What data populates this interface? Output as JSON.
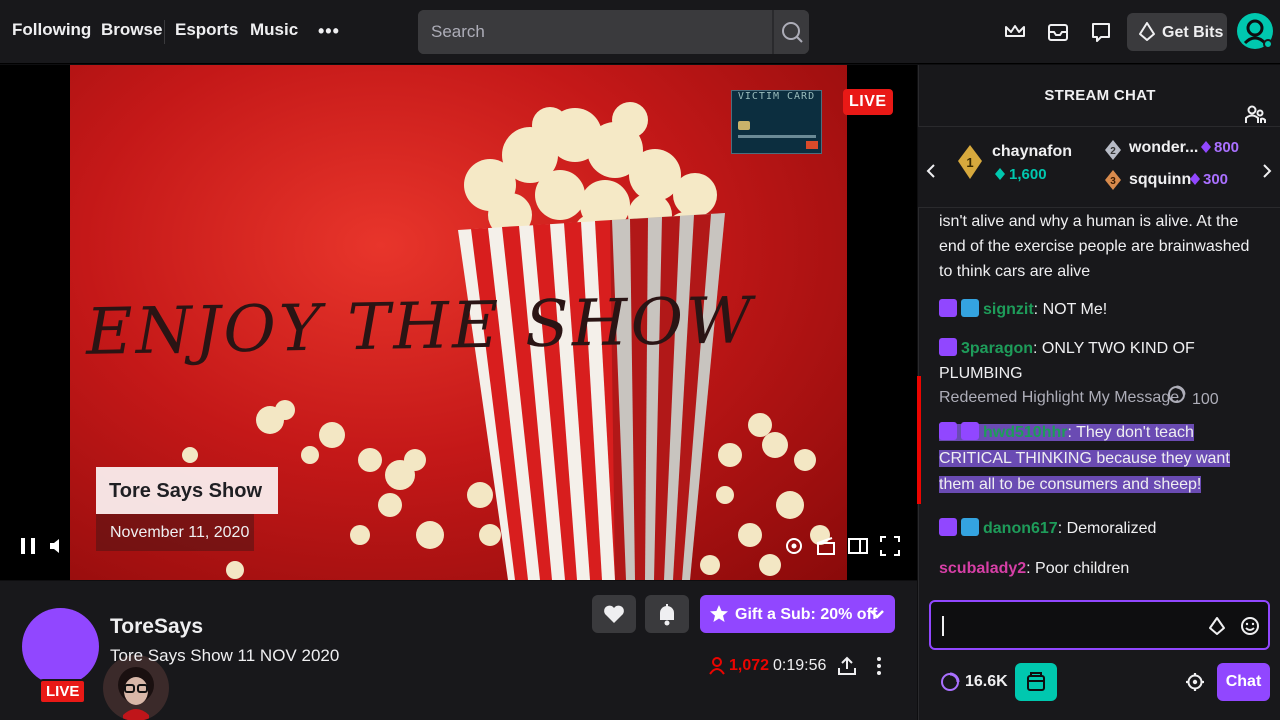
{
  "nav": {
    "following": "Following",
    "browse": "Browse",
    "esports": "Esports",
    "music": "Music",
    "more": "•••",
    "search_placeholder": "Search",
    "get_bits": "Get Bits"
  },
  "player": {
    "overlay_text": "ENJOY THE SHOW",
    "live_badge": "LIVE",
    "card_text": "VICTIM CARD",
    "show_title": "Tore Says Show",
    "show_date": "November 11, 2020"
  },
  "channel": {
    "name": "ToreSays",
    "title": "Tore Says Show 11 NOV 2020",
    "live_badge": "LIVE",
    "gift_label": "Gift a Sub: 20% off",
    "viewers": "1,072",
    "uptime": "0:19:56"
  },
  "chat": {
    "title": "STREAM CHAT",
    "leaderboard": [
      {
        "rank": "1",
        "name": "chaynafon",
        "amount": "1,600"
      },
      {
        "rank": "2",
        "name": "wonder...",
        "amount": "800"
      },
      {
        "rank": "3",
        "name": "sqquinn",
        "amount": "300"
      }
    ],
    "intro_text": "isn't alive and why a human is alive. At the end of the exercise people are brainwashed to think cars are alive",
    "messages": [
      {
        "user": "signzit",
        "text": ": NOT Me!",
        "color": "#1e9c5a"
      },
      {
        "user": "3paragon",
        "text": ": ONLY TWO KIND OF PLUMBING",
        "color": "#1e9c5a"
      },
      {
        "user": "hwd510hhr",
        "text": ": They don't teach CRITICAL THINKING because they want them all to be consumers and sheep!",
        "color": "#1e9c5a"
      },
      {
        "user": "danon617",
        "text": ": Demoralized",
        "color": "#1e9c5a"
      },
      {
        "user": "scubalady2",
        "text": ": Poor children",
        "color": "#d63fa6"
      }
    ],
    "redeem_title": "Redeemed Highlight My Message",
    "redeem_cost": "100",
    "points": "16.6K",
    "chat_button": "Chat"
  },
  "colors": {
    "accent": "#9147ff",
    "live": "#e91916",
    "points": "#00c8af"
  }
}
